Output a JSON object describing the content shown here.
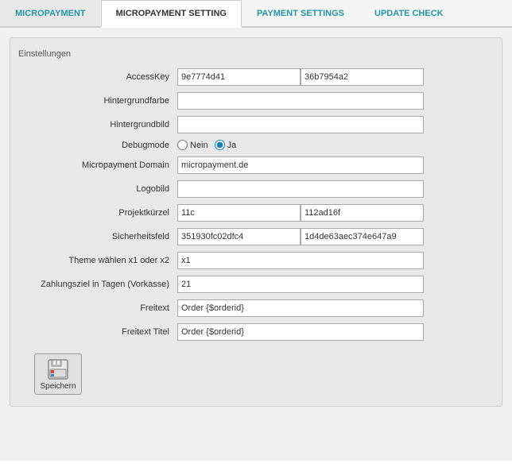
{
  "tabs": [
    {
      "id": "micropayment",
      "label": "MICROPAYMENT",
      "active": false
    },
    {
      "id": "micropayment-setting",
      "label": "MICROPAYMENT SETTING",
      "active": true
    },
    {
      "id": "payment-settings",
      "label": "PAYMENT SETTINGS",
      "active": false
    },
    {
      "id": "update-check",
      "label": "UPDATE CHECK",
      "active": false
    }
  ],
  "panel": {
    "title": "Einstellungen"
  },
  "fields": [
    {
      "id": "access-key",
      "label": "AccessKey",
      "type": "dual",
      "value1": "9e7774d41",
      "value2": "36b7954a2"
    },
    {
      "id": "hintergrundfarbe",
      "label": "Hintergrundfarbe",
      "type": "text",
      "value": ""
    },
    {
      "id": "hintergrundbild",
      "label": "Hintergrundbild",
      "type": "text",
      "value": ""
    },
    {
      "id": "debugmode",
      "label": "Debugmode",
      "type": "radio",
      "options": [
        "Nein",
        "Ja"
      ],
      "selected": "Ja"
    },
    {
      "id": "micropayment-domain",
      "label": "Micropayment Domain",
      "type": "text",
      "value": "micropayment.de"
    },
    {
      "id": "logobild",
      "label": "Logobild",
      "type": "text",
      "value": ""
    },
    {
      "id": "projektkuerzel",
      "label": "Projektkürzel",
      "type": "dual",
      "value1": "11c",
      "value2": "112ad16f"
    },
    {
      "id": "sicherheitsfeld",
      "label": "Sicherheitsfeld",
      "type": "dual",
      "value1": "351930fc02dfc4",
      "value2": "1d4de63aec374e647a9"
    },
    {
      "id": "theme",
      "label": "Theme wählen x1 oder x2",
      "type": "text",
      "value": "x1"
    },
    {
      "id": "zahlungsziel",
      "label": "Zahlungsziel in Tagen (Vorkasse)",
      "type": "text",
      "value": "21"
    },
    {
      "id": "freitext",
      "label": "Freitext",
      "type": "text",
      "value": "Order {$orderid}"
    },
    {
      "id": "freitext-titel",
      "label": "Freitext Titel",
      "type": "text",
      "value": "Order {$orderid}"
    }
  ],
  "save_button": {
    "label": "Speichern"
  }
}
